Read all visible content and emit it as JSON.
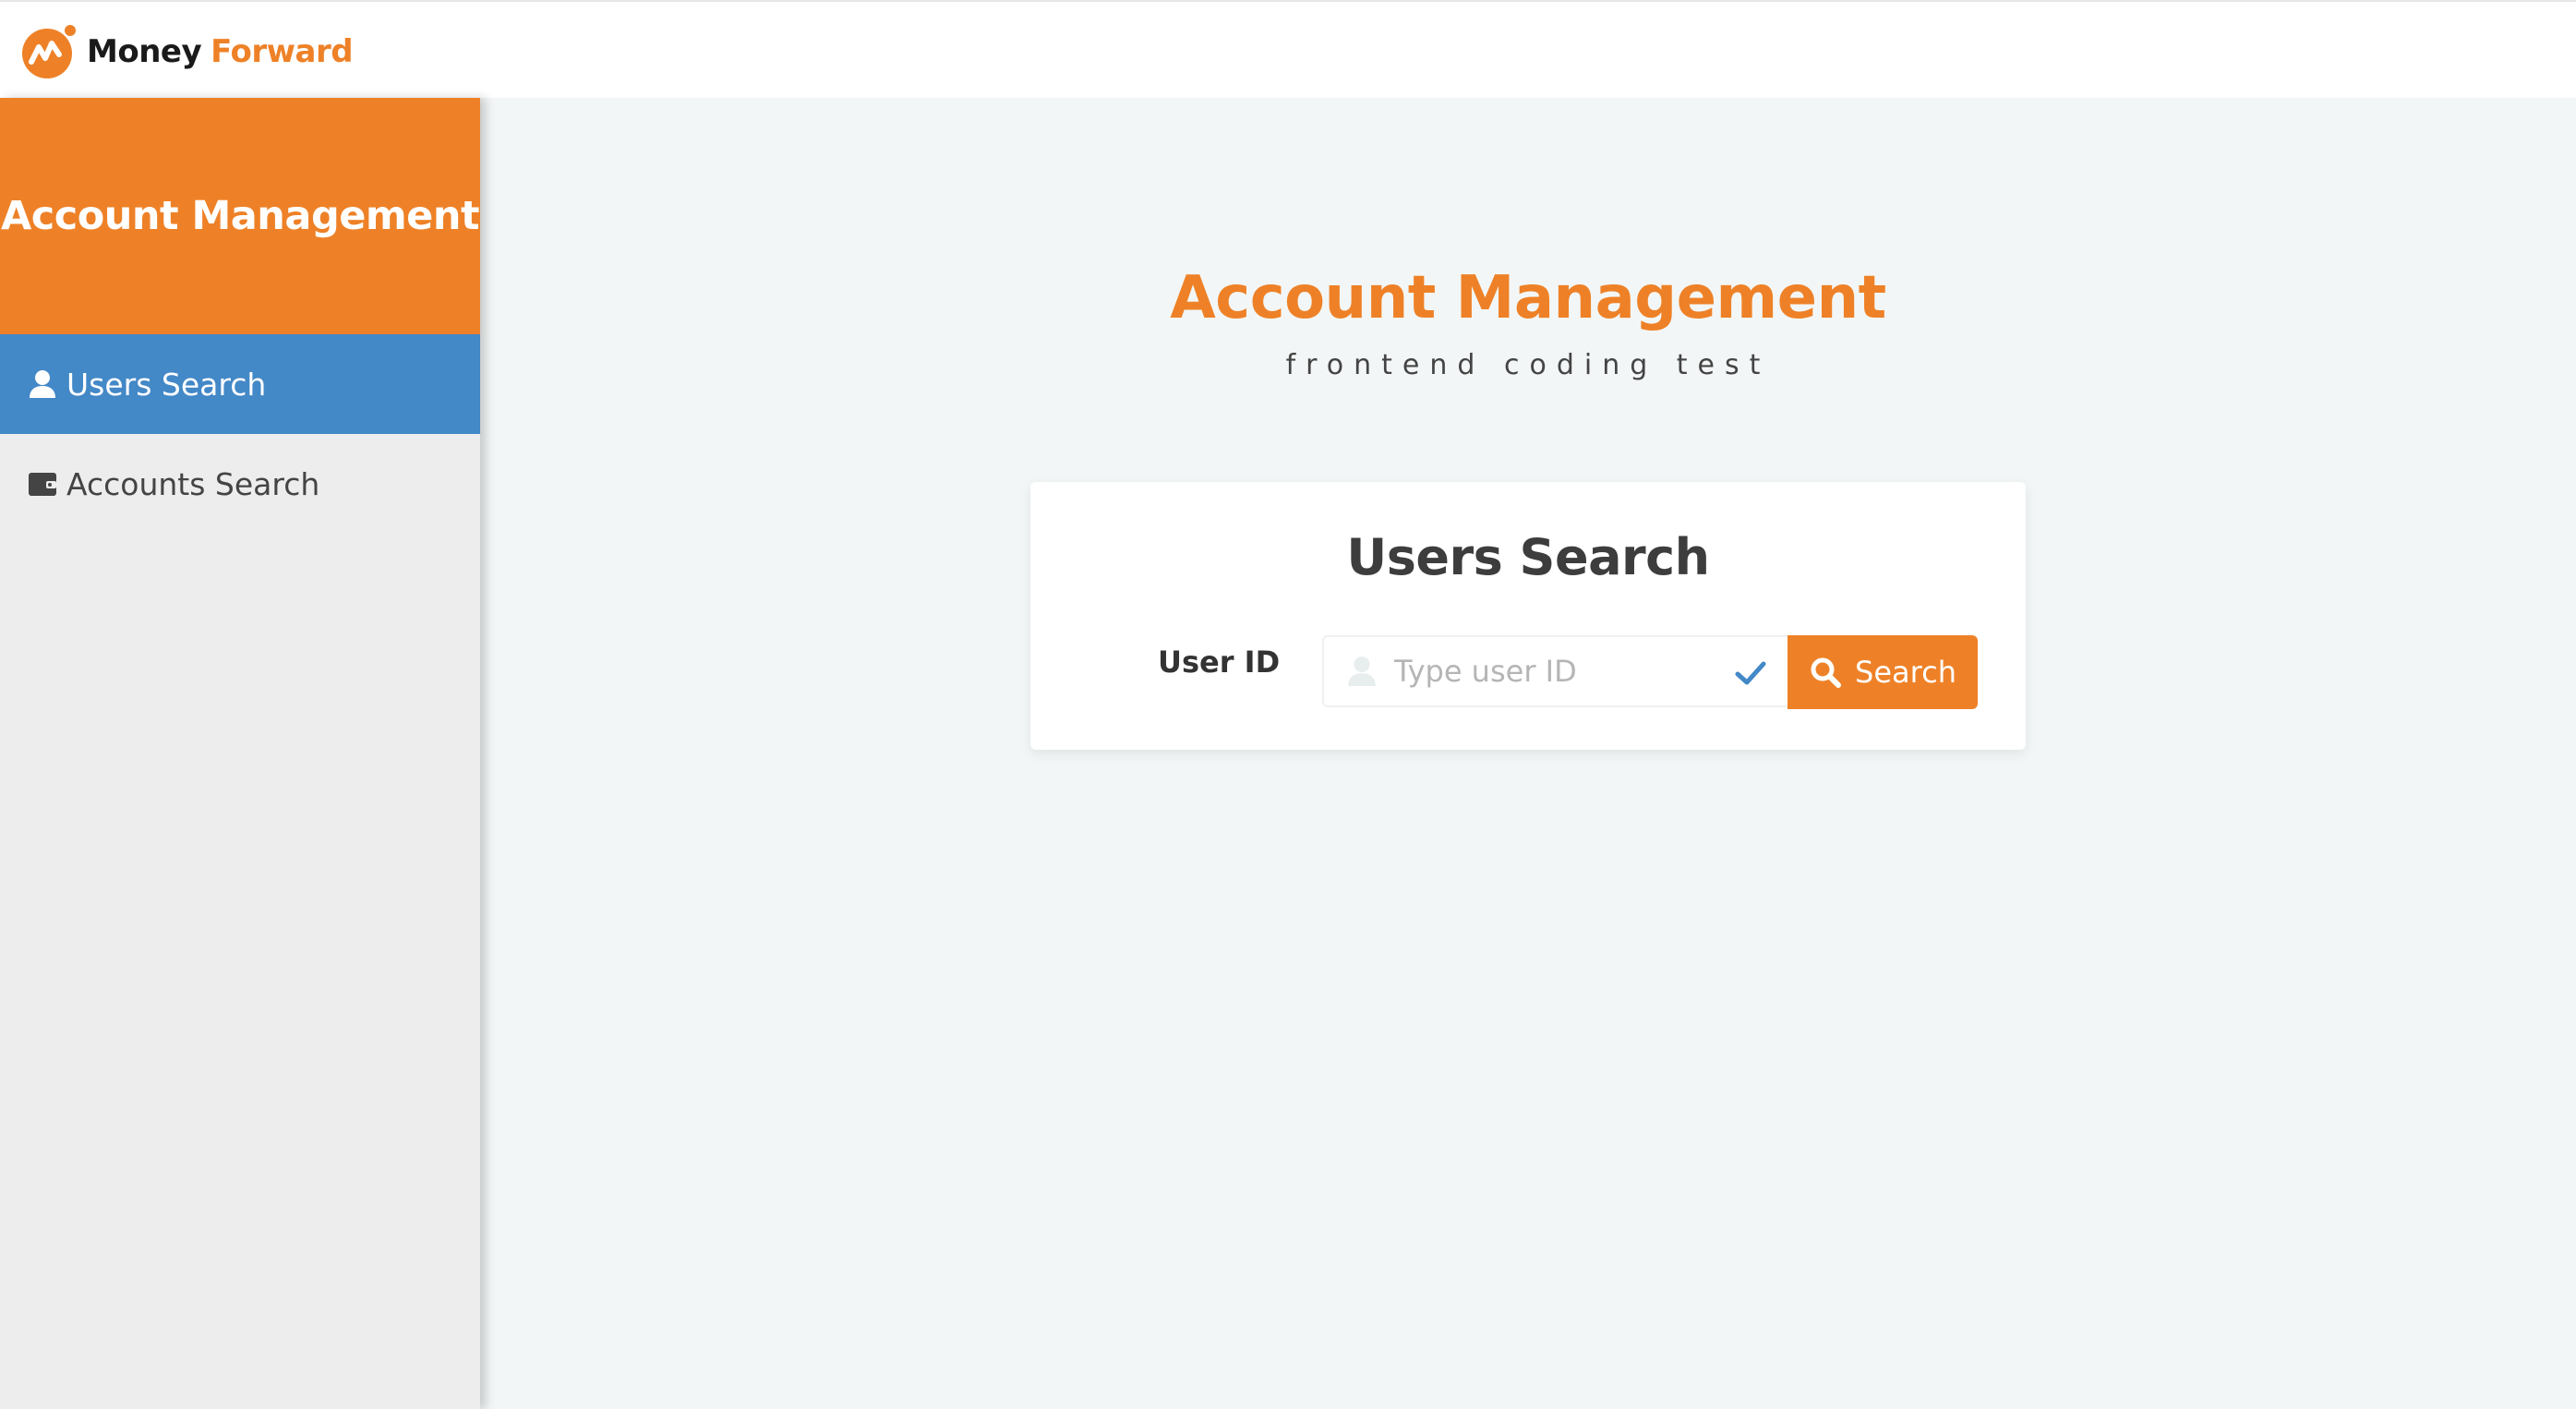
{
  "topbar": {
    "logo_money": "Money",
    "logo_forward": "Forward"
  },
  "sidebar": {
    "title": "Account Management",
    "items": [
      {
        "label": "Users Search",
        "icon": "user-icon",
        "active": true
      },
      {
        "label": "Accounts Search",
        "icon": "wallet-icon",
        "active": false
      }
    ]
  },
  "main": {
    "title": "Account Management",
    "subtitle": "frontend coding test"
  },
  "search_card": {
    "title": "Users Search",
    "field_label": "User ID",
    "input_placeholder": "Type user ID",
    "input_value": "",
    "button_label": "Search"
  },
  "colors": {
    "brand_orange": "#ee8127",
    "active_blue": "#4388c7",
    "sidebar_bg": "#ededed",
    "main_bg": "#f3f6f6"
  }
}
